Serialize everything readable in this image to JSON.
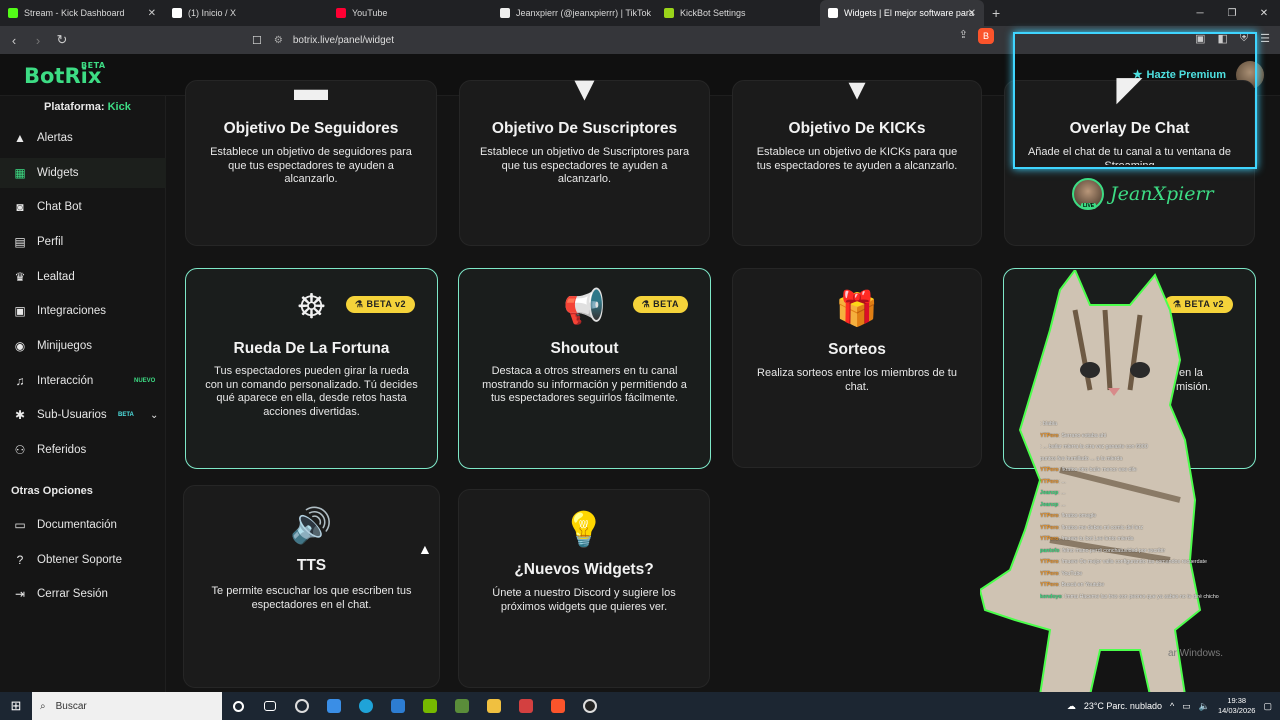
{
  "browser": {
    "tabs": [
      {
        "label": "Stream - Kick Dashboard",
        "color": "#53fc18"
      },
      {
        "label": "(1) Inicio / X",
        "color": "#ffffff"
      },
      {
        "label": "YouTube",
        "color": "#ff0000"
      },
      {
        "label": "Jeanxpierr (@jeanxpierrr) | TikTok",
        "color": "#ffffff"
      },
      {
        "label": "KickBot Settings",
        "color": "#53fc18"
      },
      {
        "label": "Widgets | El mejor software para",
        "color": "#ffffff",
        "active": true
      }
    ],
    "new_tab": "+",
    "url": "botrix.live/panel/widget"
  },
  "app": {
    "logo": "BotRix",
    "logo_badge": "BETA",
    "premium_label": "Hazte Premium",
    "platform_label": "Plataforma:",
    "platform_value": "Kick",
    "menu": [
      {
        "label": "Alertas",
        "icon": "warning-icon"
      },
      {
        "label": "Widgets",
        "icon": "widgets-icon",
        "active": true
      },
      {
        "label": "Chat Bot",
        "icon": "robot-icon"
      },
      {
        "label": "Perfil",
        "icon": "id-card-icon"
      },
      {
        "label": "Lealtad",
        "icon": "trophy-icon"
      },
      {
        "label": "Integraciones",
        "icon": "integrations-icon"
      },
      {
        "label": "Minijuegos",
        "icon": "gamepad-icon"
      },
      {
        "label": "Interacción",
        "icon": "music-icon",
        "badge": "NUEVO"
      },
      {
        "label": "Sub-Usuarios",
        "icon": "users-icon",
        "badge": "BETA"
      },
      {
        "label": "Referidos",
        "icon": "referrals-icon"
      }
    ],
    "other_title": "Otras Opciones",
    "other_menu": [
      {
        "label": "Documentación",
        "icon": "docs-icon"
      },
      {
        "label": "Obtener Soporte",
        "icon": "help-icon"
      },
      {
        "label": "Cerrar Sesión",
        "icon": "logout-icon"
      }
    ]
  },
  "cards": [
    {
      "title": "Objetivo De Seguidores",
      "desc": "Establece un objetivo de seguidores para que tus espectadores te ayuden a alcanzarlo."
    },
    {
      "title": "Objetivo De Suscriptores",
      "desc": "Establece un objetivo de Suscriptores para que tus espectadores te ayuden a alcanzarlo."
    },
    {
      "title": "Objetivo De KICKs",
      "desc": "Establece un objetivo de KICKs para que tus espectadores te ayuden a alcanzarlo."
    },
    {
      "title": "Overlay De Chat",
      "desc": "Añade el chat de tu canal a tu ventana de Streaming"
    },
    {
      "title": "Rueda De La Fortuna",
      "desc": "Tus espectadores pueden girar la rueda con un comando personalizado. Tú decides qué aparece en ella, desde retos hasta acciones divertidas.",
      "badge": "BETA v2"
    },
    {
      "title": "Shoutout",
      "desc": "Destaca a otros streamers en tu canal mostrando su información y permitiendo a tus espectadores seguirlos fácilmente.",
      "badge": "BETA"
    },
    {
      "title": "Sorteos",
      "desc": "Realiza sorteos entre los miembros de tu chat."
    },
    {
      "title": "",
      "desc": "Le pe                 ensibles en la                    resos aume                       misión.",
      "badge": "BETA v2"
    },
    {
      "title": "TTS",
      "desc": "Te permite escuchar los que escriben tus espectadores en el chat."
    },
    {
      "title": "¿Nuevos Widgets?",
      "desc": "Únete a nuestro Discord y sugiere los próximos widgets que quieres ver."
    }
  ],
  "stream_overlay": {
    "streamer_name": "JeanXpierr",
    "live": "LIVE",
    "chat": [
      {
        "user": "",
        "msg": ": blabla"
      },
      {
        "user": "YTPero",
        "msg": ": Serrano estaba ahi"
      },
      {
        "user": "",
        "msg": ": ... bailar mierra la otra vez ganaste con 6000"
      },
      {
        "user": "",
        "msg": "puntos fea humillado ... a la mierda"
      },
      {
        "user": "YTPero",
        "msg": ": !kratos otro baile menor ese dile"
      },
      {
        "user": "YTPero",
        "msg": ": ..."
      },
      {
        "user": "Jeanxp",
        "msg": ": ..."
      },
      {
        "user": "Jeanxp",
        "msg": ": ..."
      },
      {
        "user": "YTPero",
        "msg": ": !kratos omegle"
      },
      {
        "user": "YTPero",
        "msg": ": !kratos me debes mi comic del lerz"
      },
      {
        "user": "YTPero",
        "msg": ": !muere tu bot Lee lento mierda"
      },
      {
        "user": "pantofo",
        "msg": ": felno mano perdi conchatuvidad por escribir"
      },
      {
        "user": "YTPero",
        "msg": ": !muere Oe mejor valla configurando tus comandos recuerdate"
      },
      {
        "user": "YTPero",
        "msg": ": YouTube"
      },
      {
        "user": "YTPero",
        "msg": ": Buscá en Youtube"
      },
      {
        "user": "kendoyo",
        "msg": ": Imma Haceme las tres son peores que ya sabes no te diré chicho"
      }
    ]
  },
  "watermark": "ar Windows.",
  "taskbar": {
    "search": "Buscar",
    "weather": "23°C  Parc. nublado",
    "time": "19:38",
    "date": "14/03/2026"
  }
}
